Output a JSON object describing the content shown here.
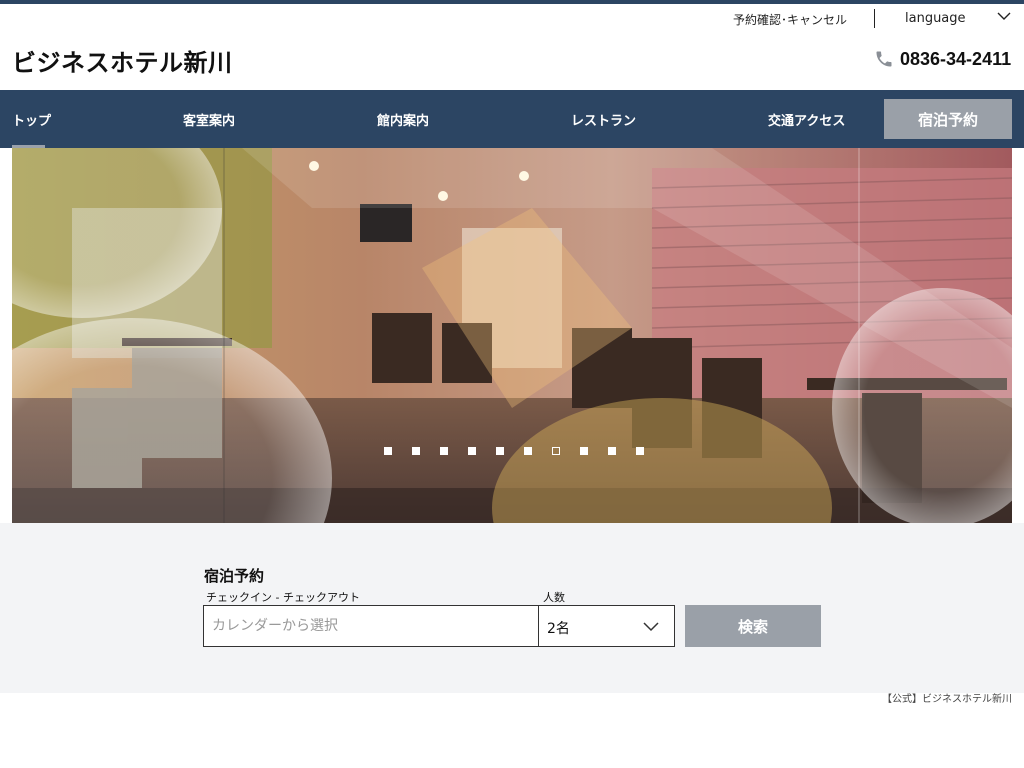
{
  "header": {
    "reservation_link": "予約確認･キャンセル",
    "language_label": "language",
    "brand_name": "ビジネスホテル新川",
    "phone_number": "0836-34-2411",
    "phone_icon": "phone-icon"
  },
  "nav": {
    "items": [
      {
        "label": "トップ",
        "active": true
      },
      {
        "label": "客室案内"
      },
      {
        "label": "館内案内"
      },
      {
        "label": "レストラン"
      },
      {
        "label": "交通アクセス"
      }
    ],
    "reserve_button": "宿泊予約"
  },
  "hero": {
    "slide_count": 10,
    "active_slide": 7
  },
  "booking": {
    "title": "宿泊予約",
    "date_label": "チェックイン - チェックアウト",
    "date_placeholder": "カレンダーから選択",
    "guests_label": "人数",
    "guests_value": "2名",
    "search_button": "検索"
  },
  "footer": {
    "note": "【公式】ビジネスホテル新川"
  },
  "colors": {
    "nav_bg": "#2c4563",
    "button_gray": "#9aa0a8",
    "booking_bg": "#f3f4f6"
  }
}
